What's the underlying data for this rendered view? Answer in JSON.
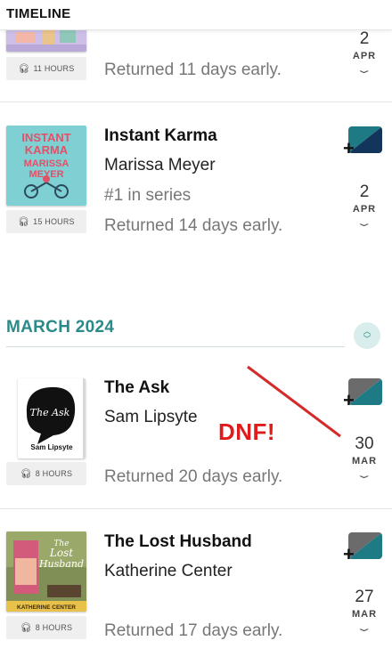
{
  "header": {
    "title": "TIMELINE"
  },
  "entries": [
    {
      "hours": "11 HOURS",
      "returned": "Returned 11 days early.",
      "day": "2",
      "month": "APR"
    },
    {
      "title": "Instant Karma",
      "author": "Marissa Meyer",
      "series": "#1 in series",
      "hours": "15 HOURS",
      "returned": "Returned 14 days early.",
      "day": "2",
      "month": "APR",
      "cover_text": [
        "INSTANT",
        "KARMA",
        "MARISSA",
        "MEYER"
      ]
    },
    {
      "title": "The Ask",
      "author": "Sam Lipsyte",
      "hours": "8 HOURS",
      "returned": "Returned 20 days early.",
      "day": "30",
      "month": "MAR",
      "cover_text": [
        "The Ask",
        "Sam Lipsyte"
      ]
    },
    {
      "title": "The Lost Husband",
      "author": "Katherine Center",
      "hours": "8 HOURS",
      "returned": "Returned 17 days early.",
      "day": "27",
      "month": "MAR",
      "cover_text": [
        "The",
        "Lost",
        "Husband",
        "KATHERINE CENTER"
      ]
    }
  ],
  "month_section": {
    "label": "MARCH 2024"
  },
  "annotation": {
    "text": "DNF!",
    "color": "#e01b1b"
  },
  "icons": {
    "headphones": "headphones-icon",
    "add": "plus-icon",
    "expand": "chevron-down-icon",
    "sort": "up-down-chevron-icon"
  },
  "colors": {
    "accent": "#2a8a88",
    "badge_teal": "#1e7b86",
    "badge_navy": "#12355b",
    "badge_gray": "#6b6b6b"
  }
}
